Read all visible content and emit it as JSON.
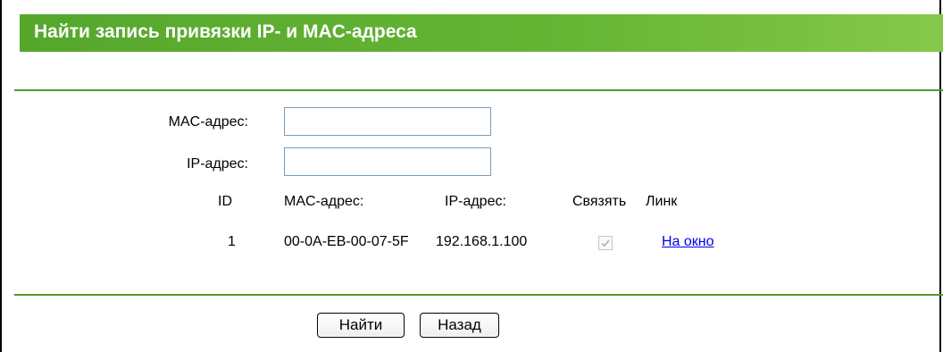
{
  "header": {
    "title": "Найти запись привязки IP- и MAC-адреса"
  },
  "form": {
    "mac_label": "MAC-адрес:",
    "mac_value": "",
    "ip_label": "IP-адрес:",
    "ip_value": ""
  },
  "table": {
    "columns": [
      "ID",
      "MAC-адрес:",
      "IP-адрес:",
      "Связять",
      "Линк"
    ],
    "rows": [
      {
        "id": "1",
        "mac": "00-0A-EB-00-07-5F",
        "ip": "192.168.1.100",
        "bind_checked": true,
        "link": "На окно"
      }
    ]
  },
  "buttons": {
    "find": "Найти",
    "back": "Назад"
  },
  "colors": {
    "title_bar": "#66b535",
    "rule": "#4f9a2a",
    "link": "#0000ee"
  }
}
